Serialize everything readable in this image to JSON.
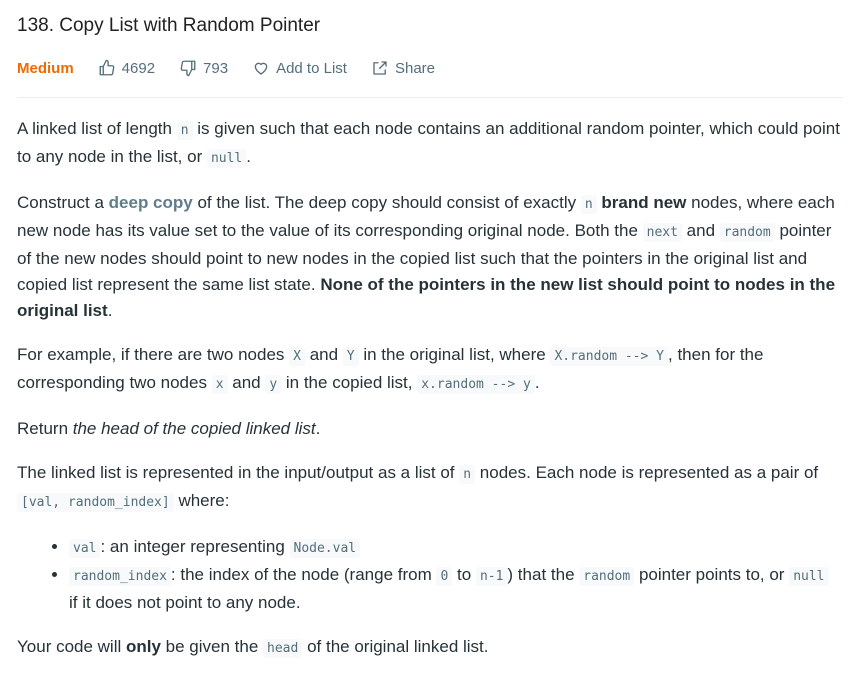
{
  "title": "138. Copy List with Random Pointer",
  "meta": {
    "difficulty": "Medium",
    "likes": "4692",
    "dislikes": "793",
    "add_to_list": "Add to List",
    "share": "Share"
  },
  "colors": {
    "difficulty": "#ef6c00",
    "text": "#263238",
    "muted": "#546e7a"
  },
  "icons": [
    "thumbs-up-icon",
    "thumbs-down-icon",
    "heart-icon",
    "share-icon"
  ],
  "p1": {
    "t1": "A linked list of length ",
    "c1": "n",
    "t2": " is given such that each node contains an additional random pointer, which could point to any node in the list, or ",
    "c2": "null",
    "t3": "."
  },
  "p2": {
    "t1": "Construct a ",
    "deep_copy": "deep copy",
    "t2": " of the list. The deep copy should consist of exactly ",
    "c1": "n",
    "t3": " ",
    "brand_new": "brand new",
    "t4": " nodes, where each new node has its value set to the value of its corresponding original node. Both the ",
    "c2": "next",
    "t5": " and ",
    "c3": "random",
    "t6": " pointer of the new nodes should point to new nodes in the copied list such that the pointers in the original list and copied list represent the same list state. ",
    "bold_end": "None of the pointers in the new list should point to nodes in the original list",
    "t7": "."
  },
  "p3": {
    "t1": "For example, if there are two nodes ",
    "c1": "X",
    "t2": " and ",
    "c2": "Y",
    "t3": " in the original list, where ",
    "c3": "X.random --> Y",
    "t4": ", then for the corresponding two nodes ",
    "c4": "x",
    "t5": " and ",
    "c5": "y",
    "t6": " in the copied list, ",
    "c6": "x.random --> y",
    "t7": "."
  },
  "p4": {
    "t1": "Return ",
    "em": "the head of the copied linked list",
    "t2": "."
  },
  "p5": {
    "t1": "The linked list is represented in the input/output as a list of ",
    "c1": "n",
    "t2": " nodes. Each node is represented as a pair of ",
    "c2": "[val, random_index]",
    "t3": " where:"
  },
  "list": {
    "i1": {
      "c1": "val",
      "t1": ": an integer representing ",
      "c2": "Node.val"
    },
    "i2": {
      "c1": "random_index",
      "t1": ": the index of the node (range from ",
      "c2": "0",
      "t2": " to ",
      "c3": "n-1",
      "t3": ") that the ",
      "c4": "random",
      "t4": " pointer points to, or ",
      "c5": "null",
      "t5": " if it does not point to any node."
    }
  },
  "p6": {
    "t1": "Your code will ",
    "b": "only",
    "t2": " be given the ",
    "c1": "head",
    "t3": " of the original linked list."
  }
}
